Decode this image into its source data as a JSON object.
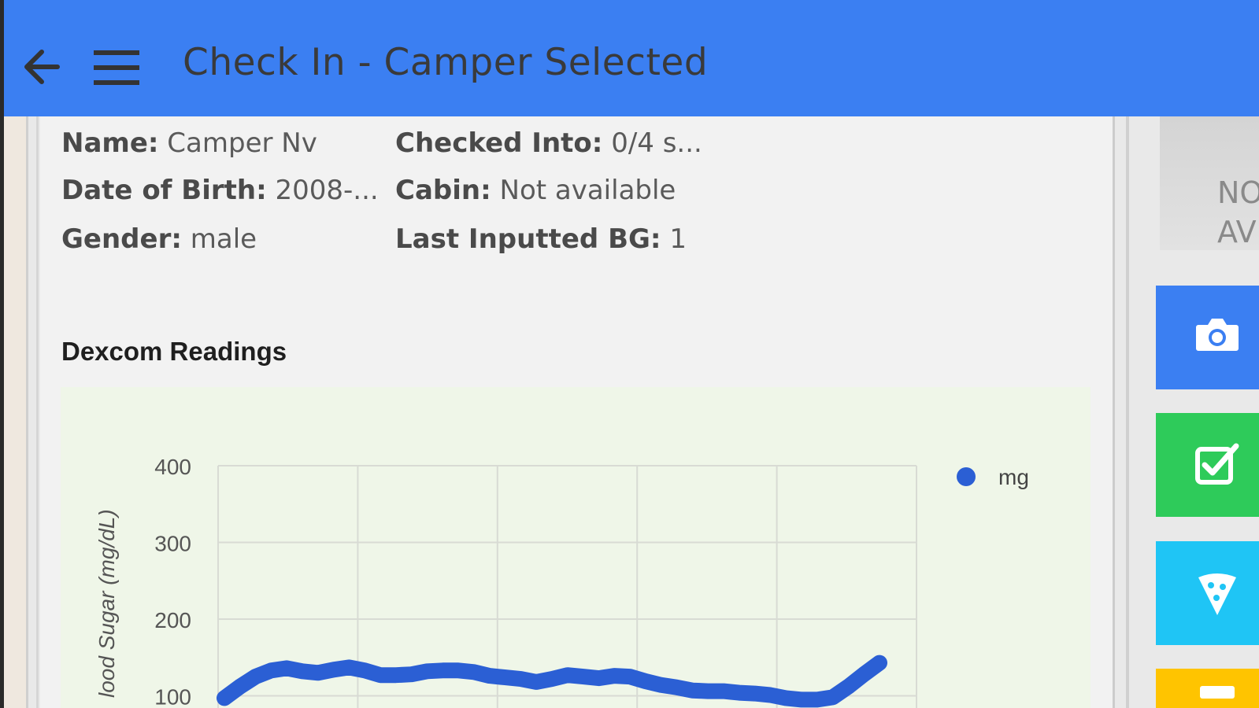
{
  "app_bar": {
    "title": "Check In - Camper Selected",
    "back_icon": "arrow-back-icon",
    "menu_icon": "hamburger-menu-icon",
    "color": "#3b7ff2"
  },
  "camper_info": {
    "name_label": "Name:",
    "name_value": "Camper Nv",
    "checked_into_label": "Checked Into:",
    "checked_into_value": "0/4 s...",
    "dob_label": "Date of Birth:",
    "dob_value": "2008-...",
    "cabin_label": "Cabin:",
    "cabin_value": "Not available",
    "gender_label": "Gender:",
    "gender_value": "male",
    "last_bg_label": "Last Inputted BG:",
    "last_bg_value": "1"
  },
  "dexcom": {
    "section_title": "Dexcom Readings"
  },
  "chart_data": {
    "type": "line",
    "xlabel": "",
    "ylabel": "Blood Sugar (mg/dL)",
    "ylabel_visible": "lood Sugar (mg/dL)",
    "y_ticks": [
      "400",
      "300",
      "200",
      "100"
    ],
    "ylim": [
      0,
      400
    ],
    "grid": true,
    "legend_position": "top-right",
    "series": [
      {
        "name": "mg",
        "color": "#2b5fd4",
        "values": [
          97,
          112,
          125,
          133,
          136,
          132,
          130,
          134,
          137,
          133,
          127,
          127,
          128,
          132,
          133,
          133,
          131,
          126,
          124,
          122,
          118,
          122,
          127,
          125,
          123,
          126,
          125,
          119,
          114,
          111,
          107,
          106,
          106,
          104,
          103,
          101,
          97,
          95,
          95,
          98,
          112,
          128,
          143
        ]
      }
    ]
  },
  "photo": {
    "text_line1": "NO",
    "text_line2": "AV"
  },
  "side_buttons": [
    {
      "name": "camera-button",
      "icon": "camera-icon",
      "color": "#3b7ff2"
    },
    {
      "name": "check-button",
      "icon": "checkbox-icon",
      "color": "#2ecb5a"
    },
    {
      "name": "food-button",
      "icon": "pizza-icon",
      "color": "#1fc5f5"
    },
    {
      "name": "yellow-button",
      "icon": "unknown-icon",
      "color": "#ffc400"
    }
  ]
}
